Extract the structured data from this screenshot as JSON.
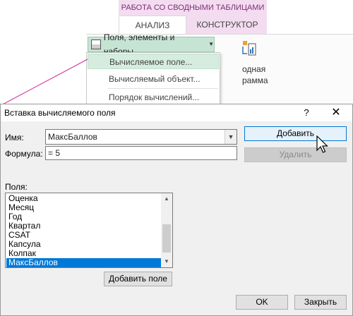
{
  "ribbon": {
    "context_header": "РАБОТА СО СВОДНЫМИ ТАБЛИЦАМИ",
    "tabs": [
      {
        "label": "АНАЛИЗ",
        "active": true
      },
      {
        "label": "КОНСТРУКТОР",
        "active": false
      }
    ],
    "fields_button_label": "Поля, элементы и наборы",
    "partial_right_text_1": "одная",
    "partial_right_text_2": "рамма",
    "accent_color": "#7a2f75"
  },
  "menu": {
    "items": [
      {
        "label": "Вычисляемое поле...",
        "highlighted": true
      },
      {
        "label": "Вычисляемый объект...",
        "highlighted": false
      },
      {
        "label": "Порядок вычислений...",
        "highlighted": false
      }
    ]
  },
  "dialog": {
    "title": "Вставка вычисляемого поля",
    "help_glyph": "?",
    "close_glyph": "✕",
    "name_label": "Имя:",
    "name_value": "МаксБаллов",
    "formula_label": "Формула:",
    "formula_value": "= 5",
    "add_button": "Добавить",
    "delete_button": "Удалить",
    "fields_label": "Поля:",
    "fields": [
      "Оценка",
      "Месяц",
      "Год",
      "Квартал",
      "CSAT",
      "Капсула",
      "Колпак",
      "МаксБаллов"
    ],
    "selected_field": "МаксБаллов",
    "add_field_button": "Добавить поле",
    "ok_button": "OK",
    "close_button": "Закрыть",
    "selection_color": "#0078d7"
  }
}
